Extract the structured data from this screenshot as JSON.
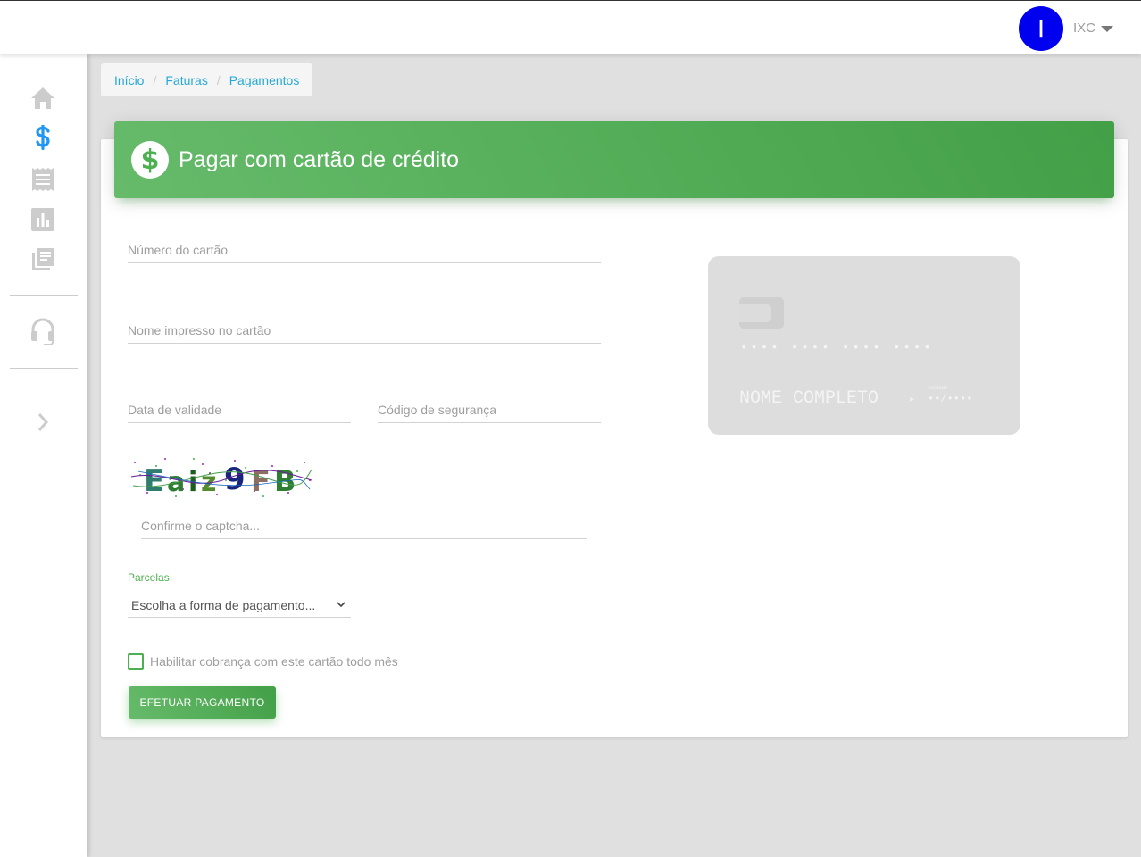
{
  "topbar": {
    "avatar_initial": "I",
    "username": "IXC"
  },
  "sidebar": {
    "items": [
      {
        "name": "home",
        "icon": "home-icon",
        "active": false
      },
      {
        "name": "faturas",
        "icon": "dollar-icon",
        "active": true
      },
      {
        "name": "receipts",
        "icon": "receipt-icon",
        "active": false
      },
      {
        "name": "reports",
        "icon": "bar-chart-icon",
        "active": false
      },
      {
        "name": "library",
        "icon": "library-books-icon",
        "active": false
      },
      {
        "name": "support",
        "icon": "headset-icon",
        "active": false
      },
      {
        "name": "expand",
        "icon": "chevron-right-icon",
        "active": false
      }
    ],
    "active_color": "#2196f3",
    "inactive_color": "#cccccc"
  },
  "breadcrumb": {
    "items": [
      "Início",
      "Faturas",
      "Pagamentos"
    ],
    "separator": "/"
  },
  "header": {
    "icon": "dollar-circle-icon",
    "icon_glyph": "$",
    "title": "Pagar com cartão de crédito"
  },
  "form": {
    "card_number": {
      "placeholder": "Número do cartão",
      "value": ""
    },
    "card_name": {
      "placeholder": "Nome impresso no cartão",
      "value": ""
    },
    "expiry": {
      "placeholder": "Data de validade",
      "value": ""
    },
    "security_code": {
      "placeholder": "Código de segurança",
      "value": ""
    },
    "captcha": {
      "text": "Eaiz9FB",
      "placeholder": "Confirme o captcha...",
      "value": ""
    },
    "parcelas": {
      "label": "Parcelas",
      "selected": "Escolha a forma de pagamento..."
    },
    "recurring": {
      "label": "Habilitar cobrança com este cartão todo mês",
      "checked": false
    },
    "submit_label": "EFETUAR PAGAMENTO"
  },
  "card_preview": {
    "number": "•••• •••• •••• ••••",
    "name": "NOME COMPLETO",
    "valid_label": "validade",
    "expiry": "••/••••"
  },
  "colors": {
    "accent_green": "#4caf50",
    "link_blue": "#26a8d8",
    "avatar_blue": "#0000ee"
  }
}
